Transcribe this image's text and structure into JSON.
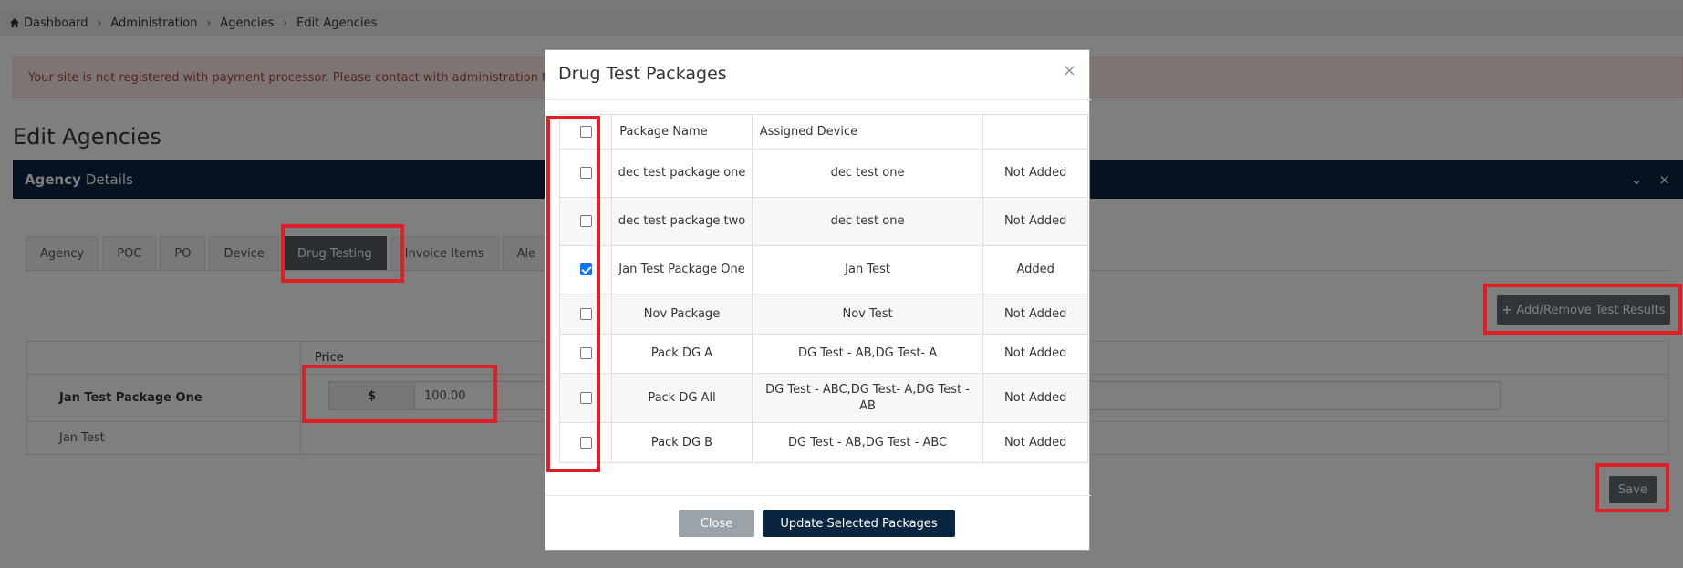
{
  "breadcrumb": [
    "Dashboard",
    "Administration",
    "Agencies",
    "Edit Agencies"
  ],
  "alert": "Your site is not registered with payment processor. Please contact with administration t",
  "page_title": "Edit Agencies",
  "panel": {
    "title_bold": "Agency",
    "title_rest": "Details",
    "collapse_glyph": "⌄",
    "close_glyph": "×"
  },
  "tabs": [
    "Agency",
    "POC",
    "PO",
    "Device",
    "Drug Testing",
    "Invoice Items",
    "Ale"
  ],
  "active_tab": "Drug Testing",
  "add_remove_label": "Add/Remove Test Results",
  "add_remove_glyph": "+",
  "price_table": {
    "price_header": "Price",
    "package_name": "Jan Test Package One",
    "currency": "$",
    "price_value": "100.00",
    "device": "Jan Test"
  },
  "save_label": "Save",
  "modal": {
    "title": "Drug Test Packages",
    "close_glyph": "×",
    "headers": [
      "Package Name",
      "Assigned Device",
      ""
    ],
    "rows": [
      {
        "name": "dec test package one",
        "device": "dec test one",
        "status": "Not Added",
        "checked": false
      },
      {
        "name": "dec test package two",
        "device": "dec test one",
        "status": "Not Added",
        "checked": false
      },
      {
        "name": "Jan Test Package One",
        "device": "Jan Test",
        "status": "Added",
        "checked": true
      },
      {
        "name": "Nov Package",
        "device": "Nov Test",
        "status": "Not Added",
        "checked": false
      },
      {
        "name": "Pack DG A",
        "device": "DG Test - AB,DG Test- A",
        "status": "Not Added",
        "checked": false
      },
      {
        "name": "Pack DG All",
        "device": "DG Test - ABC,DG Test- A,DG Test - AB",
        "status": "Not Added",
        "checked": false
      },
      {
        "name": "Pack DG B",
        "device": "DG Test - AB,DG Test - ABC",
        "status": "Not Added",
        "checked": false
      }
    ],
    "close_label": "Close",
    "update_label": "Update Selected Packages"
  },
  "colors": {
    "navy": "#0a2540",
    "annotation": "#e01e26",
    "checkbox": "#0075ff"
  }
}
